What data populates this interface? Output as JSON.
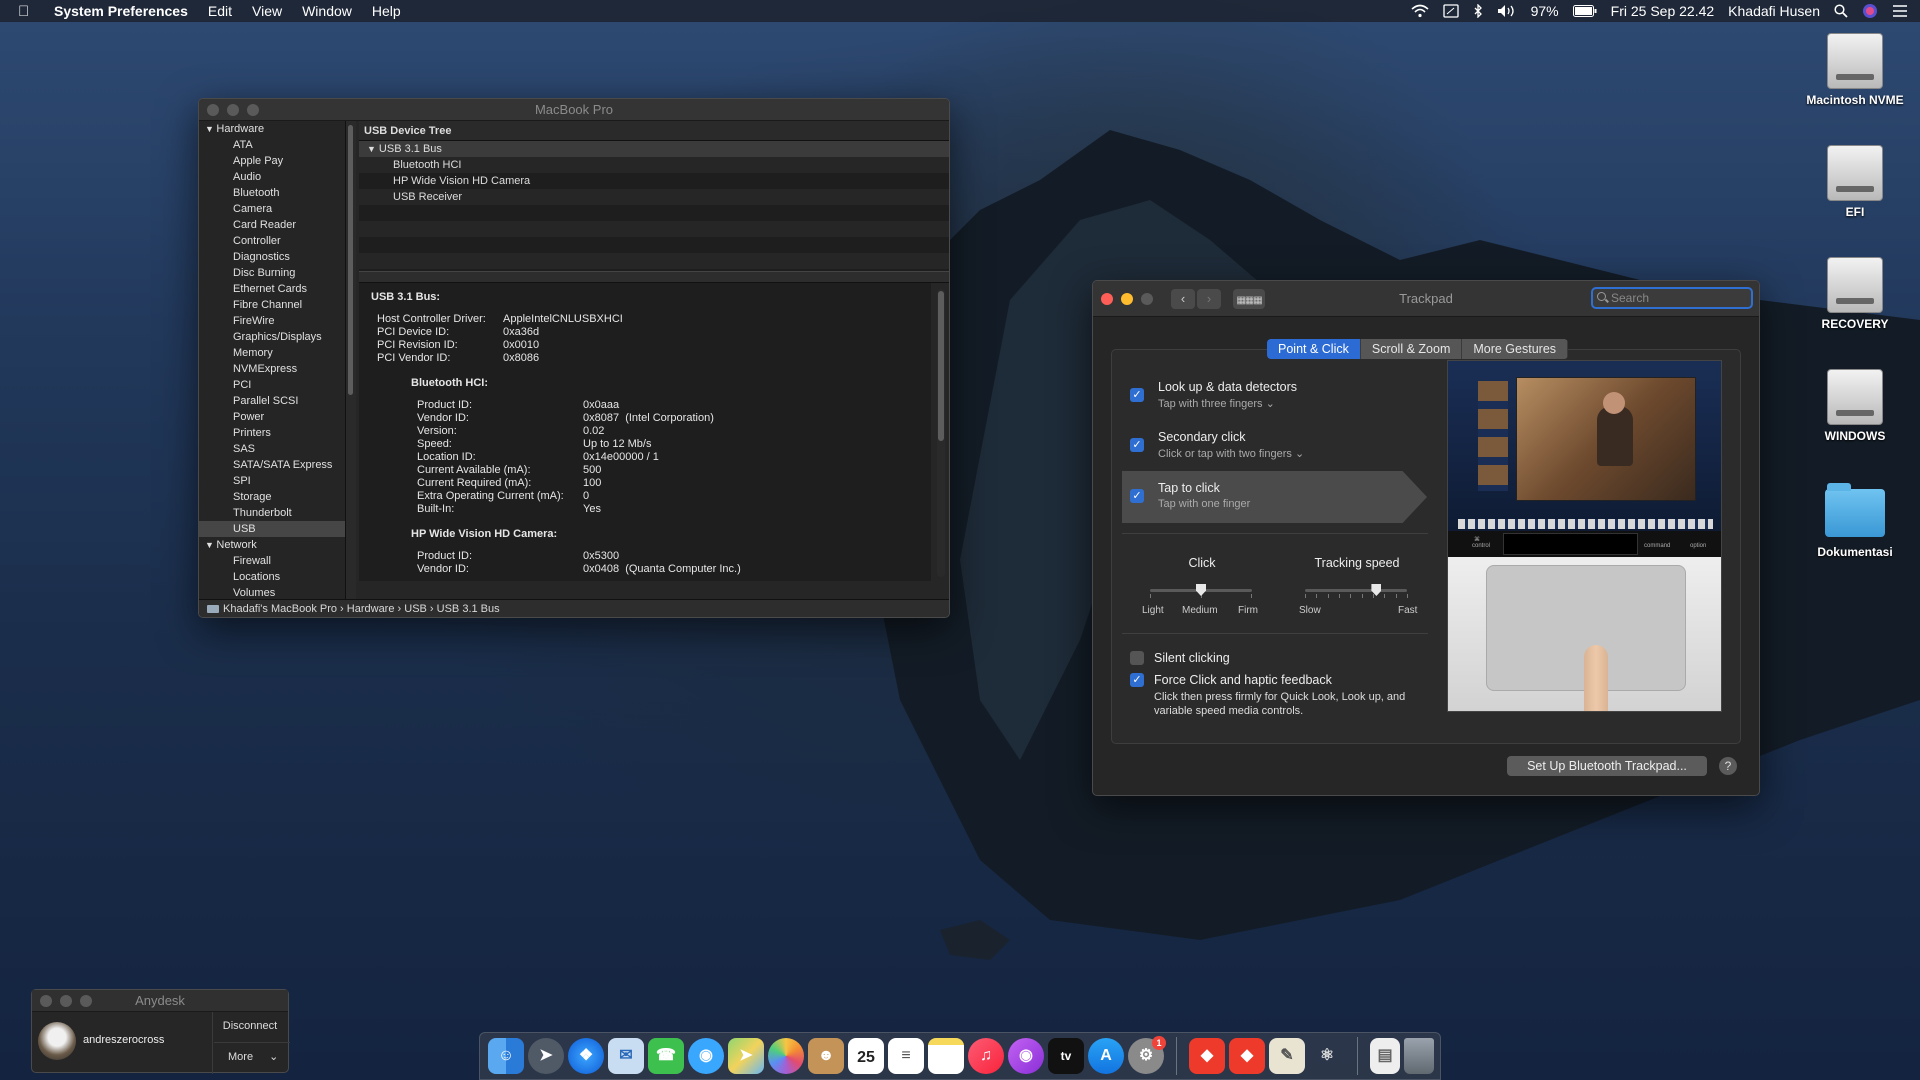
{
  "menubar": {
    "app": "System Preferences",
    "items": [
      "Edit",
      "View",
      "Window",
      "Help"
    ],
    "battery": "97%",
    "datetime": "Fri 25 Sep  22.42",
    "user": "Khadafi Husen"
  },
  "desktop": {
    "icons": [
      "Macintosh NVME",
      "EFI",
      "RECOVERY",
      "WINDOWS",
      "Dokumentasi"
    ]
  },
  "sysinfo": {
    "title": "MacBook Pro",
    "sidebar": [
      {
        "label": "Hardware",
        "level": 0
      },
      {
        "label": "ATA",
        "level": 1
      },
      {
        "label": "Apple Pay",
        "level": 1
      },
      {
        "label": "Audio",
        "level": 1
      },
      {
        "label": "Bluetooth",
        "level": 1
      },
      {
        "label": "Camera",
        "level": 1
      },
      {
        "label": "Card Reader",
        "level": 1
      },
      {
        "label": "Controller",
        "level": 1
      },
      {
        "label": "Diagnostics",
        "level": 1
      },
      {
        "label": "Disc Burning",
        "level": 1
      },
      {
        "label": "Ethernet Cards",
        "level": 1
      },
      {
        "label": "Fibre Channel",
        "level": 1
      },
      {
        "label": "FireWire",
        "level": 1
      },
      {
        "label": "Graphics/Displays",
        "level": 1
      },
      {
        "label": "Memory",
        "level": 1
      },
      {
        "label": "NVMExpress",
        "level": 1
      },
      {
        "label": "PCI",
        "level": 1
      },
      {
        "label": "Parallel SCSI",
        "level": 1
      },
      {
        "label": "Power",
        "level": 1
      },
      {
        "label": "Printers",
        "level": 1
      },
      {
        "label": "SAS",
        "level": 1
      },
      {
        "label": "SATA/SATA Express",
        "level": 1
      },
      {
        "label": "SPI",
        "level": 1
      },
      {
        "label": "Storage",
        "level": 1
      },
      {
        "label": "Thunderbolt",
        "level": 1
      },
      {
        "label": "USB",
        "level": 1,
        "selected": true
      },
      {
        "label": "Network",
        "level": 0
      },
      {
        "label": "Firewall",
        "level": 1
      },
      {
        "label": "Locations",
        "level": 1
      },
      {
        "label": "Volumes",
        "level": 1
      }
    ],
    "tree_header": "USB Device Tree",
    "tree": [
      {
        "label": "USB 3.1 Bus",
        "level": 0
      },
      {
        "label": "Bluetooth HCI",
        "level": 1
      },
      {
        "label": "HP Wide Vision HD Camera",
        "level": 1
      },
      {
        "label": "USB Receiver",
        "level": 1
      }
    ],
    "detail": {
      "heading": "USB 3.1 Bus:",
      "bus": [
        [
          "Host Controller Driver:",
          "AppleIntelCNLUSBXHCI"
        ],
        [
          "PCI Device ID:",
          "0xa36d"
        ],
        [
          "PCI Revision ID:",
          "0x0010"
        ],
        [
          "PCI Vendor ID:",
          "0x8086"
        ]
      ],
      "bt_heading": "Bluetooth HCI:",
      "bt": [
        [
          "Product ID:",
          "0x0aaa"
        ],
        [
          "Vendor ID:",
          "0x8087  (Intel Corporation)"
        ],
        [
          "Version:",
          "0.02"
        ],
        [
          "Speed:",
          "Up to 12 Mb/s"
        ],
        [
          "Location ID:",
          "0x14e00000 / 1"
        ],
        [
          "Current Available (mA):",
          "500"
        ],
        [
          "Current Required (mA):",
          "100"
        ],
        [
          "Extra Operating Current (mA):",
          "0"
        ],
        [
          "Built-In:",
          "Yes"
        ]
      ],
      "cam_heading": "HP Wide Vision HD Camera:",
      "cam": [
        [
          "Product ID:",
          "0x5300"
        ],
        [
          "Vendor ID:",
          "0x0408  (Quanta Computer Inc.)"
        ]
      ]
    },
    "path": [
      "Khadafi's MacBook Pro",
      "Hardware",
      "USB",
      "USB 3.1 Bus"
    ]
  },
  "trackpad": {
    "title": "Trackpad",
    "search_placeholder": "Search",
    "tabs": [
      "Point & Click",
      "Scroll & Zoom",
      "More Gestures"
    ],
    "options": [
      {
        "title": "Look up & data detectors",
        "sub": "Tap with three fingers",
        "checked": true
      },
      {
        "title": "Secondary click",
        "sub": "Click or tap with two fingers",
        "checked": true
      },
      {
        "title": "Tap to click",
        "sub": "Tap with one finger",
        "checked": true
      }
    ],
    "click_label": "Click",
    "click_ticks": [
      "Light",
      "Medium",
      "Firm"
    ],
    "click_value": 0.5,
    "speed_label": "Tracking speed",
    "speed_ticks": [
      "Slow",
      "Fast"
    ],
    "speed_value": 0.7,
    "silent": "Silent clicking",
    "force": "Force Click and haptic feedback",
    "force_desc": "Click then press firmly for Quick Look, Look up, and variable speed media controls.",
    "bt_button": "Set Up Bluetooth Trackpad...",
    "help": "?",
    "preview_keys": [
      "control",
      "command",
      "option"
    ]
  },
  "anydesk": {
    "title": "Anydesk",
    "user": "andreszerocross",
    "disconnect": "Disconnect",
    "more": "More"
  },
  "dock": {
    "calendar_day": "25",
    "appletv": "tv",
    "badge": "1"
  },
  "colors": {
    "accent": "#2f6fd1",
    "close": "#ff5f57",
    "minimize": "#febc2e"
  }
}
